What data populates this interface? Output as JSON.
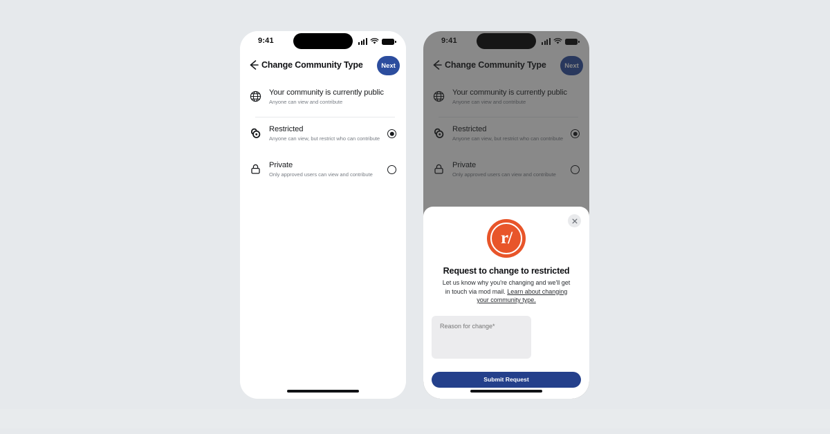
{
  "background_color": "#e6e9ec",
  "status_bar": {
    "time": "9:41",
    "signal_icon": "cellular-signal-icon",
    "wifi_icon": "wifi-icon",
    "battery_icon": "battery-icon"
  },
  "nav": {
    "back_icon": "back-arrow-icon",
    "title": "Change Community Type",
    "next_label": "Next",
    "next_color": "#2c4d9e"
  },
  "options": [
    {
      "icon": "globe-icon",
      "title": "Your community is currently public",
      "subtitle": "Anyone can view and contribute",
      "radio": "none"
    },
    {
      "icon": "restricted-icon",
      "title": "Restricted",
      "subtitle": "Anyone can view, but restrict who can contribute",
      "radio": "selected"
    },
    {
      "icon": "lock-icon",
      "title": "Private",
      "subtitle": "Only approved users can view and contribute",
      "radio": "unselected"
    }
  ],
  "modal": {
    "close_icon": "close-icon",
    "logo_icon": "reddit-r-slash-logo",
    "logo_color": "#e8552a",
    "title": "Request to change to restricted",
    "body_text": "Let us know why you're changing and we'll get in touch via mod mail. ",
    "link_text": "Learn about changing your community type.",
    "reason_placeholder": "Reason for change",
    "required_marker": "*",
    "submit_label": "Submit Request",
    "submit_color": "#24408b"
  }
}
